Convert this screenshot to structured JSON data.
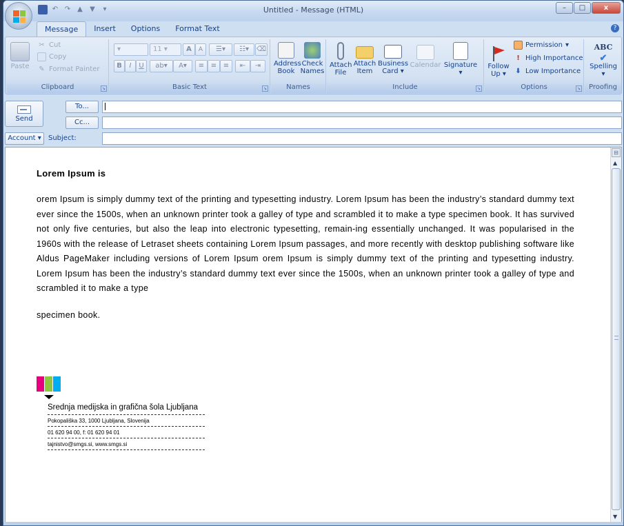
{
  "window": {
    "title": "Untitled - Message (HTML)",
    "minimize": "–",
    "maximize": "□",
    "close": "x"
  },
  "quick_access": {
    "undo": "↶",
    "redo": "↷",
    "up": "▲",
    "down": "▼",
    "customize": "▾"
  },
  "tabs": [
    {
      "label": "Message",
      "active": true
    },
    {
      "label": "Insert"
    },
    {
      "label": "Options"
    },
    {
      "label": "Format Text"
    }
  ],
  "help": "?",
  "clipboard": {
    "paste": "Paste",
    "cut": "Cut",
    "copy": "Copy",
    "format_painter": "Format Painter",
    "group_label": "Clipboard"
  },
  "basic_text": {
    "font_size": "11",
    "grow": "A",
    "shrink": "A",
    "bold": "B",
    "italic": "I",
    "underline": "U",
    "group_label": "Basic Text"
  },
  "names": {
    "address_book": "Address Book",
    "check_names": "Check Names",
    "group_label": "Names"
  },
  "include": {
    "attach_file": "Attach File",
    "attach_item": "Attach Item",
    "business_card": "Business Card",
    "calendar": "Calendar",
    "signature": "Signature",
    "group_label": "Include"
  },
  "options": {
    "follow_up": "Follow Up",
    "permission": "Permission",
    "high_importance": "High Importance",
    "low_importance": "Low Importance",
    "group_label": "Options"
  },
  "proofing": {
    "spelling": "Spelling",
    "abc": "ABC",
    "group_label": "Proofing"
  },
  "header": {
    "send": "Send",
    "to_button": "To...",
    "cc_button": "Cc...",
    "account_button": "Account",
    "subject_label": "Subject:",
    "to_value": "",
    "cc_value": "",
    "subject_value": ""
  },
  "message": {
    "heading": "Lorem Ipsum is",
    "paragraph": "orem Ipsum is simply dummy text of the printing and typesetting industry. Lorem Ipsum has been the industry’s standard dummy text ever since the 1500s, when an unknown printer took a galley of type and scrambled it to make a type specimen book. It has survived not only five centuries, but also the leap into electronic typesetting, remain-ing essentially unchanged. It was popularised in the 1960s with the release of Letraset sheets containing Lorem Ipsum passages, and more recently with desktop publishing software like Aldus PageMaker including versions of Lorem Ipsum orem Ipsum is simply dummy text of the printing and typesetting industry. Lorem Ipsum has been the industry’s standard dummy text ever since the 1500s, when an unknown printer took a galley of type and scrambled it to make a type",
    "closing": "specimen book."
  },
  "signature": {
    "name": "Srednja medijska in grafična šola Ljubljana",
    "address": "Pokopališka 33, 1000 Ljubljana, Slovenija",
    "phone": "01 620 94 00, f: 01 620 94 01",
    "contact": "tajnistvo@smgs.si, www.smgs.si",
    "logo_colors": [
      "#e6007e",
      "#8dc63f",
      "#00aeef"
    ]
  },
  "colors": {
    "ribbon_text": "#15428b",
    "office_logo": [
      "#f26522",
      "#8dc63f",
      "#00aeef",
      "#fbb040"
    ]
  }
}
